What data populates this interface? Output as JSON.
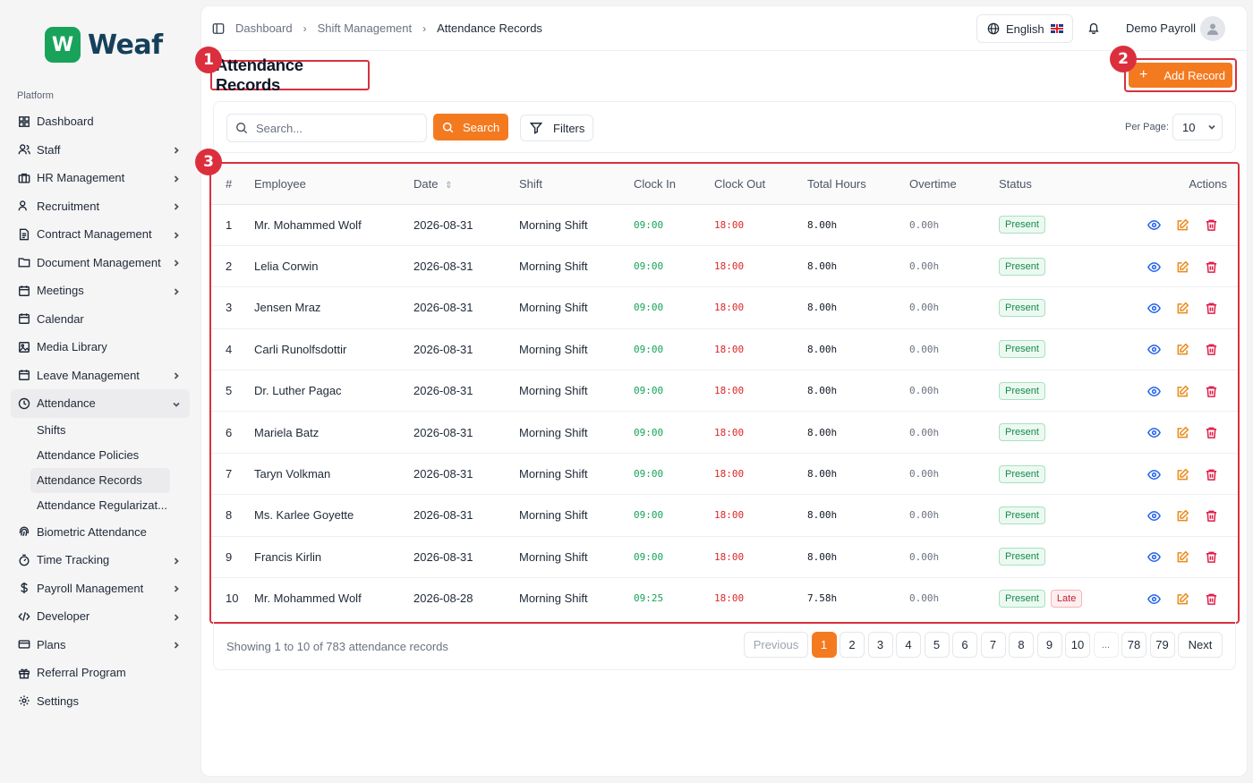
{
  "app": {
    "logo_letter": "W",
    "logo_name": "Weaf",
    "brand_color": "#19a35a",
    "accent_color": "#f47a20"
  },
  "sidebar": {
    "section_label": "Platform",
    "items": [
      {
        "label": "Dashboard",
        "icon": "grid-icon",
        "chevron": false
      },
      {
        "label": "Staff",
        "icon": "users-icon",
        "chevron": true
      },
      {
        "label": "HR Management",
        "icon": "briefcase-icon",
        "chevron": true
      },
      {
        "label": "Recruitment",
        "icon": "user-plus-icon",
        "chevron": true
      },
      {
        "label": "Contract Management",
        "icon": "file-text-icon",
        "chevron": true
      },
      {
        "label": "Document Management",
        "icon": "folder-icon",
        "chevron": true
      },
      {
        "label": "Meetings",
        "icon": "calendar-icon",
        "chevron": true
      },
      {
        "label": "Calendar",
        "icon": "calendar-icon",
        "chevron": false
      },
      {
        "label": "Media Library",
        "icon": "image-icon",
        "chevron": false
      },
      {
        "label": "Leave Management",
        "icon": "calendar-icon",
        "chevron": true
      },
      {
        "label": "Attendance",
        "icon": "clock-icon",
        "chevron": true
      }
    ],
    "attendance_sub": [
      {
        "label": "Shifts"
      },
      {
        "label": "Attendance Policies"
      },
      {
        "label": "Attendance Records"
      },
      {
        "label": "Attendance Regularizat..."
      }
    ],
    "items_after": [
      {
        "label": "Biometric Attendance",
        "icon": "fingerprint-icon",
        "chevron": false
      },
      {
        "label": "Time Tracking",
        "icon": "timer-icon",
        "chevron": true
      },
      {
        "label": "Payroll Management",
        "icon": "dollar-icon",
        "chevron": true
      },
      {
        "label": "Developer",
        "icon": "code-icon",
        "chevron": true
      },
      {
        "label": "Plans",
        "icon": "card-icon",
        "chevron": true
      },
      {
        "label": "Referral Program",
        "icon": "gift-icon",
        "chevron": false
      },
      {
        "label": "Settings",
        "icon": "gear-icon",
        "chevron": false
      }
    ]
  },
  "header": {
    "breadcrumb": [
      "Dashboard",
      "Shift Management",
      "Attendance Records"
    ],
    "language": "English",
    "user_name": "Demo Payroll"
  },
  "page": {
    "title": "Attendance Records",
    "add_button": "Add Record",
    "markers": [
      "1",
      "2",
      "3"
    ]
  },
  "toolbar": {
    "search_placeholder": "Search...",
    "search_button": "Search",
    "filters_button": "Filters",
    "per_page_label": "Per Page:",
    "per_page_value": "10"
  },
  "table": {
    "columns": [
      "#",
      "Employee",
      "Date",
      "Shift",
      "Clock In",
      "Clock Out",
      "Total Hours",
      "Overtime",
      "Status",
      "Actions"
    ],
    "rows": [
      {
        "num": "1",
        "employee": "Mr. Mohammed Wolf",
        "date": "2026-08-31",
        "shift": "Morning Shift",
        "clock_in": "09:00",
        "clock_out": "18:00",
        "total": "8.00h",
        "overtime": "0.00h",
        "status": "Present",
        "extra": ""
      },
      {
        "num": "2",
        "employee": "Lelia Corwin",
        "date": "2026-08-31",
        "shift": "Morning Shift",
        "clock_in": "09:00",
        "clock_out": "18:00",
        "total": "8.00h",
        "overtime": "0.00h",
        "status": "Present",
        "extra": ""
      },
      {
        "num": "3",
        "employee": "Jensen Mraz",
        "date": "2026-08-31",
        "shift": "Morning Shift",
        "clock_in": "09:00",
        "clock_out": "18:00",
        "total": "8.00h",
        "overtime": "0.00h",
        "status": "Present",
        "extra": ""
      },
      {
        "num": "4",
        "employee": "Carli Runolfsdottir",
        "date": "2026-08-31",
        "shift": "Morning Shift",
        "clock_in": "09:00",
        "clock_out": "18:00",
        "total": "8.00h",
        "overtime": "0.00h",
        "status": "Present",
        "extra": ""
      },
      {
        "num": "5",
        "employee": "Dr. Luther Pagac",
        "date": "2026-08-31",
        "shift": "Morning Shift",
        "clock_in": "09:00",
        "clock_out": "18:00",
        "total": "8.00h",
        "overtime": "0.00h",
        "status": "Present",
        "extra": ""
      },
      {
        "num": "6",
        "employee": "Mariela Batz",
        "date": "2026-08-31",
        "shift": "Morning Shift",
        "clock_in": "09:00",
        "clock_out": "18:00",
        "total": "8.00h",
        "overtime": "0.00h",
        "status": "Present",
        "extra": ""
      },
      {
        "num": "7",
        "employee": "Taryn Volkman",
        "date": "2026-08-31",
        "shift": "Morning Shift",
        "clock_in": "09:00",
        "clock_out": "18:00",
        "total": "8.00h",
        "overtime": "0.00h",
        "status": "Present",
        "extra": ""
      },
      {
        "num": "8",
        "employee": "Ms. Karlee Goyette",
        "date": "2026-08-31",
        "shift": "Morning Shift",
        "clock_in": "09:00",
        "clock_out": "18:00",
        "total": "8.00h",
        "overtime": "0.00h",
        "status": "Present",
        "extra": ""
      },
      {
        "num": "9",
        "employee": "Francis Kirlin",
        "date": "2026-08-31",
        "shift": "Morning Shift",
        "clock_in": "09:00",
        "clock_out": "18:00",
        "total": "8.00h",
        "overtime": "0.00h",
        "status": "Present",
        "extra": ""
      },
      {
        "num": "10",
        "employee": "Mr. Mohammed Wolf",
        "date": "2026-08-28",
        "shift": "Morning Shift",
        "clock_in": "09:25",
        "clock_out": "18:00",
        "total": "7.58h",
        "overtime": "0.00h",
        "status": "Present",
        "extra": "Late"
      }
    ]
  },
  "footer": {
    "showing": "Showing 1 to 10 of 783 attendance records",
    "previous": "Previous",
    "next": "Next",
    "pages": [
      "1",
      "2",
      "3",
      "4",
      "5",
      "6",
      "7",
      "8",
      "9",
      "10",
      "...",
      "78",
      "79"
    ],
    "current_page": "1"
  }
}
